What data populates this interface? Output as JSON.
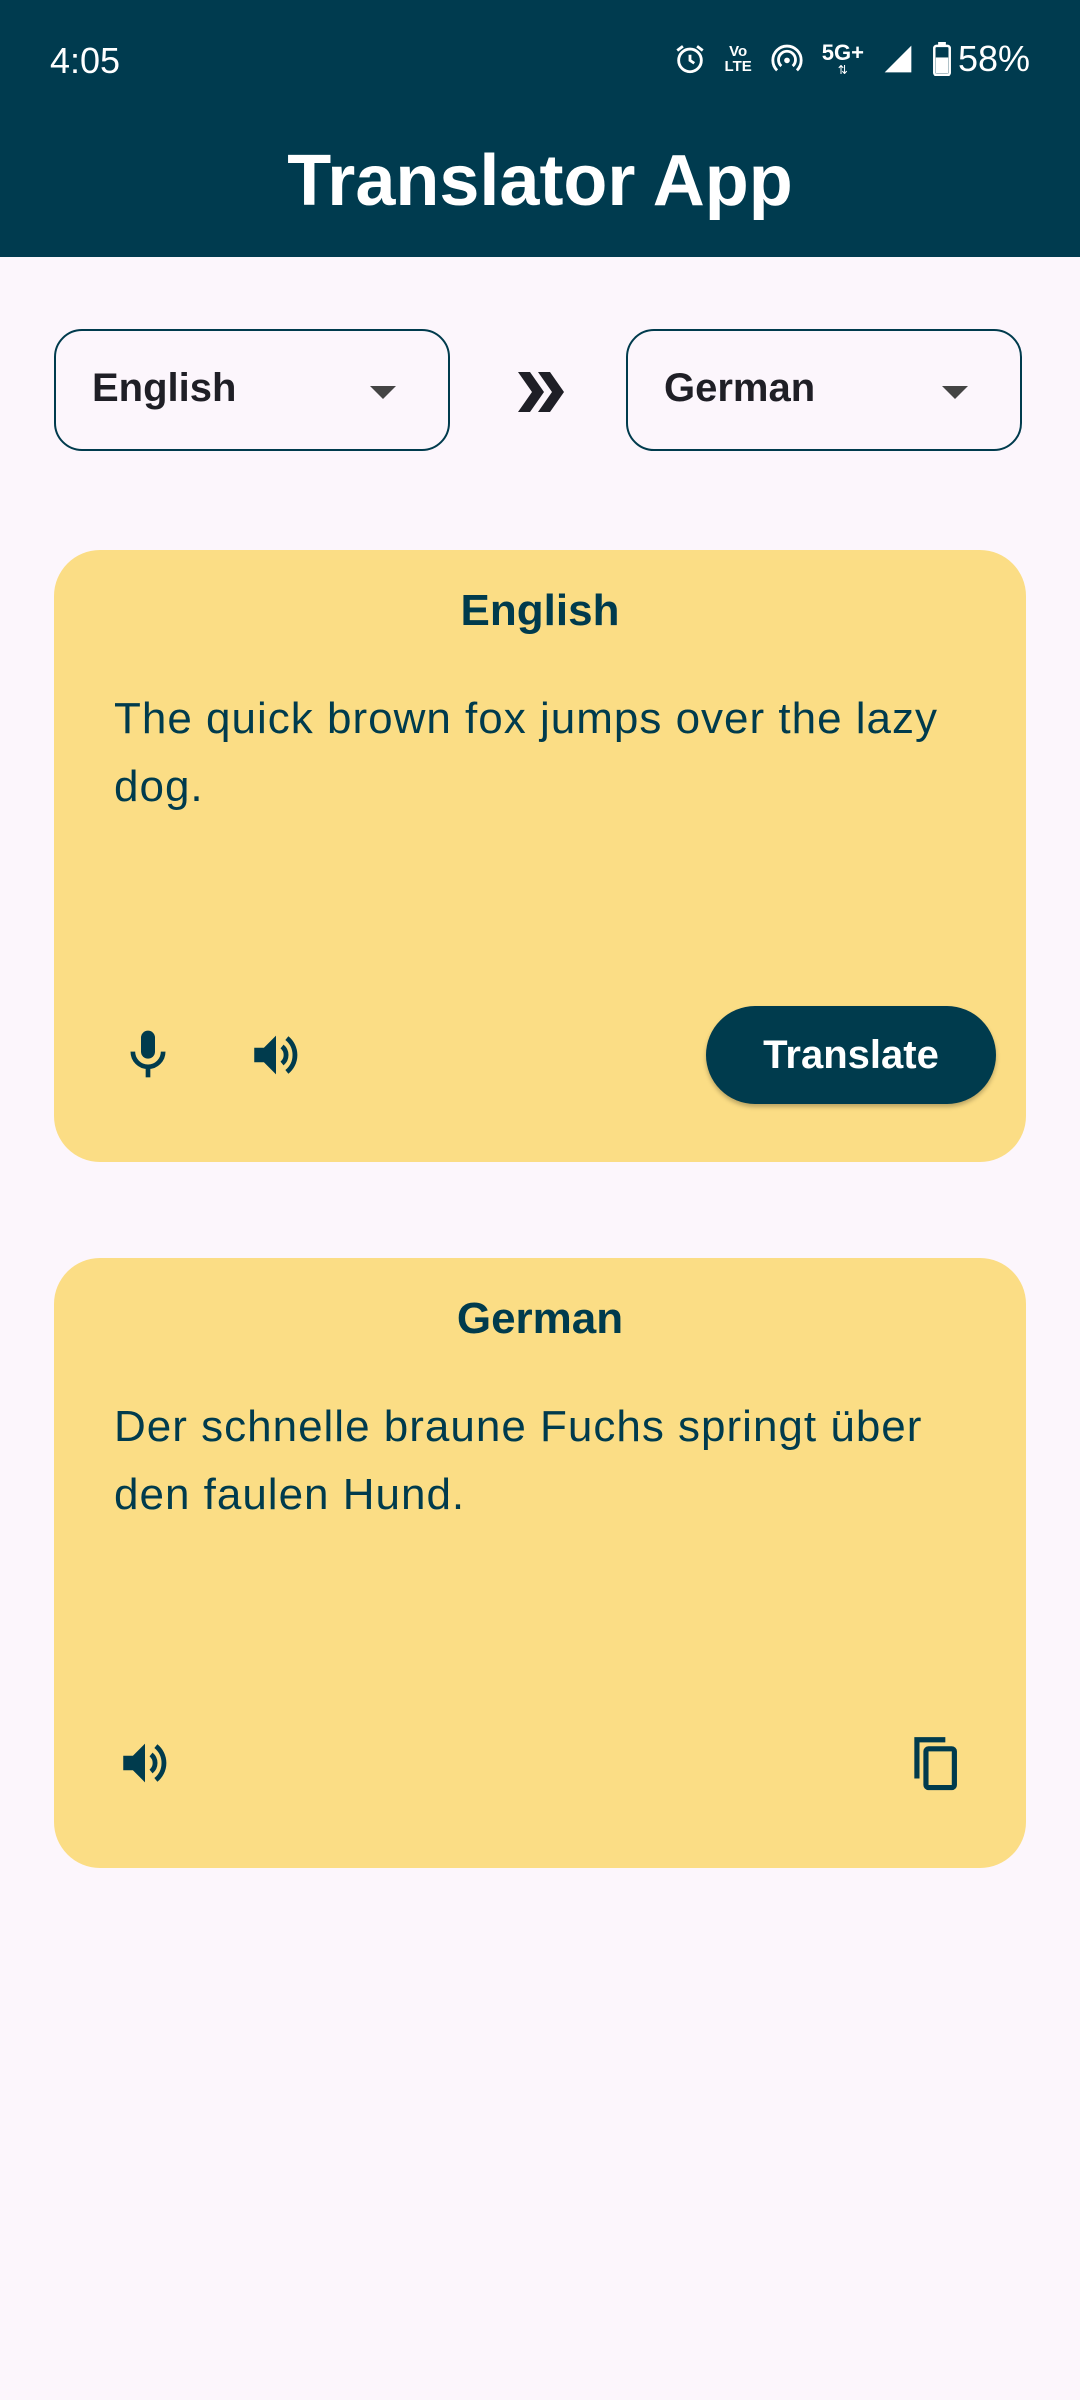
{
  "status_bar": {
    "time": "4:05",
    "volte_top": "Vo",
    "volte_bottom": "LTE",
    "network": "5G+",
    "battery": "58%"
  },
  "header": {
    "title": "Translator App"
  },
  "language_selector": {
    "source": "English",
    "target": "German"
  },
  "source_card": {
    "title": "English",
    "text": "The quick brown fox jumps over the lazy dog.",
    "translate_label": "Translate"
  },
  "target_card": {
    "title": "German",
    "text": "Der schnelle braune Fuchs springt über den faulen Hund."
  },
  "colors": {
    "primary": "#003b4d",
    "card": "#fbdd85",
    "background": "#fcf6fc"
  }
}
